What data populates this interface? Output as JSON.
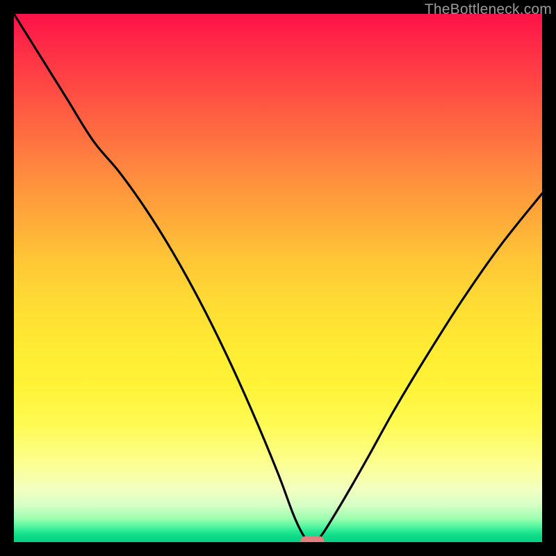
{
  "watermark": "TheBottleneck.com",
  "colors": {
    "frame": "#000000",
    "curve": "#000000",
    "marker_fill": "#e37f7f",
    "gradient_top": "#ff1249",
    "gradient_bottom": "#06d184"
  },
  "chart_data": {
    "type": "line",
    "title": "",
    "xlabel": "",
    "ylabel": "",
    "xlim": [
      0,
      100
    ],
    "ylim": [
      0,
      100
    ],
    "x": [
      0,
      5,
      10,
      15,
      20,
      25,
      30,
      35,
      40,
      45,
      50,
      53,
      55,
      56.5,
      58,
      60,
      63,
      67,
      72,
      78,
      85,
      92,
      100
    ],
    "y": [
      100,
      92,
      84,
      76,
      70,
      63,
      55,
      46,
      36,
      25,
      13,
      5,
      1,
      0,
      1,
      4,
      9,
      16,
      25,
      35,
      46,
      56,
      66
    ],
    "minimum_marker": {
      "x": 56.5,
      "y": 0,
      "shape": "rounded-rect"
    },
    "note": "Axes are unlabeled in source image; values are relative percentages estimated from pixel positions."
  }
}
